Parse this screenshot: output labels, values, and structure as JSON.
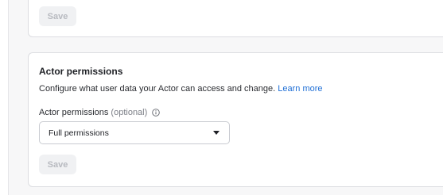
{
  "top_card": {
    "save_label": "Save"
  },
  "permissions_card": {
    "title": "Actor permissions",
    "description": "Configure what user data your Actor can access and change.",
    "learn_more": "Learn more",
    "field_label": "Actor permissions",
    "field_optional": "(optional)",
    "select_value": "Full permissions",
    "save_label": "Save"
  },
  "colors": {
    "link": "#1f6fd6",
    "disabled_button_bg": "#f0f1f3",
    "disabled_button_text": "#b8bac0"
  },
  "icons": {
    "info": "info-circle-icon",
    "dropdown": "caret-down-icon"
  }
}
